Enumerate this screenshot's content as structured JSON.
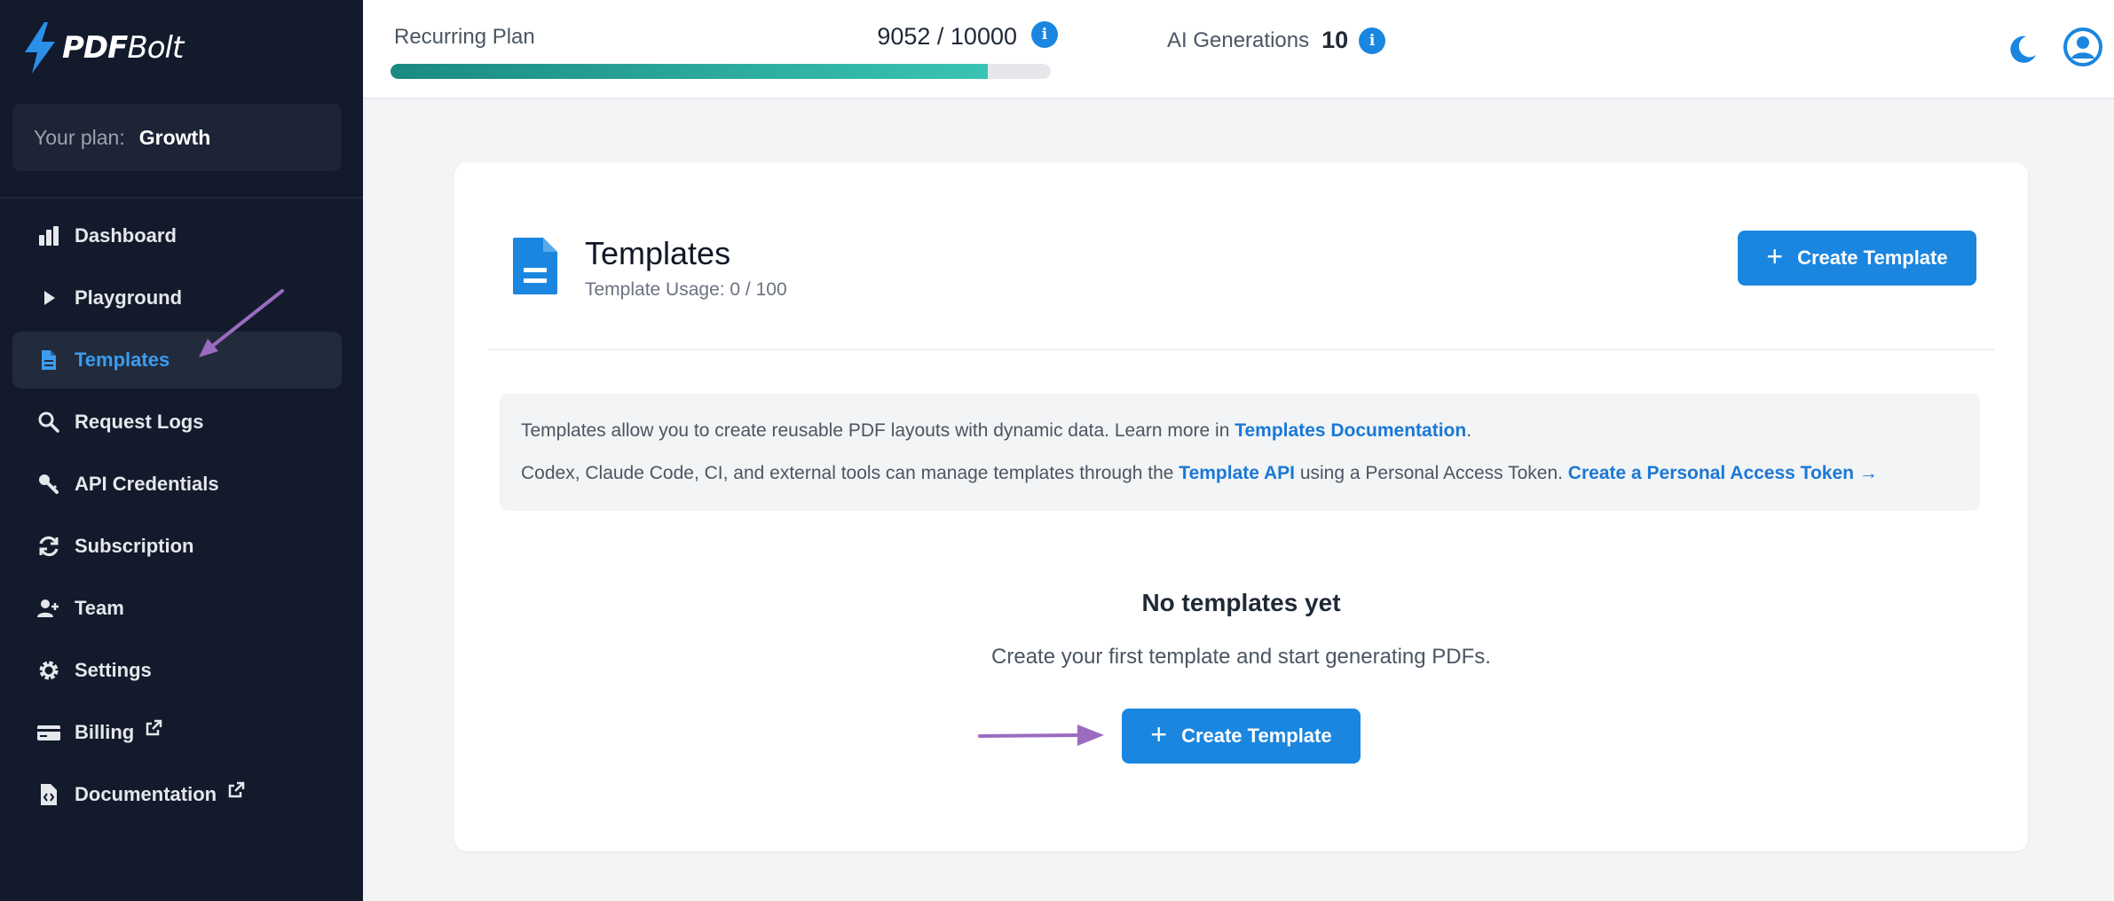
{
  "app": {
    "logo_left": "PDF",
    "logo_right": "Bolt"
  },
  "plan": {
    "label": "Your plan:",
    "value": "Growth"
  },
  "nav": [
    {
      "label": "Dashboard",
      "icon": "bar-chart-icon"
    },
    {
      "label": "Playground",
      "icon": "play-icon"
    },
    {
      "label": "Templates",
      "icon": "document-icon",
      "active": true
    },
    {
      "label": "Request Logs",
      "icon": "search-icon"
    },
    {
      "label": "API Credentials",
      "icon": "key-icon"
    },
    {
      "label": "Subscription",
      "icon": "refresh-icon"
    },
    {
      "label": "Team",
      "icon": "team-icon"
    },
    {
      "label": "Settings",
      "icon": "gear-icon"
    },
    {
      "label": "Billing",
      "icon": "credit-card-icon",
      "external": true
    },
    {
      "label": "Documentation",
      "icon": "code-file-icon",
      "external": true
    }
  ],
  "topbar": {
    "usage_label": "Recurring Plan",
    "usage_count": "9052 / 10000",
    "usage_fraction": 0.9052,
    "ai_label": "AI Generations",
    "ai_count": "10",
    "info_glyph": "i"
  },
  "templates": {
    "title": "Templates",
    "usage": "Template Usage: 0 / 100",
    "create_button": "Create Template",
    "notice_line1_prefix": "Templates allow you to create reusable PDF layouts with dynamic data. Learn more in ",
    "notice_line1_link": "Templates Documentation",
    "notice_line1_suffix": ".",
    "notice_line2_prefix": "Codex, Claude Code, CI, and external tools can manage templates through the ",
    "notice_line2_link1": "Template API",
    "notice_line2_mid": " using a Personal Access Token. ",
    "notice_line2_link2": "Create a Personal Access Token",
    "notice_line2_arrow": "→",
    "empty_title": "No templates yet",
    "empty_sub": "Create your first template and start generating PDFs.",
    "plus_glyph": "+"
  },
  "colors": {
    "sidebar_bg": "#121a2c",
    "accent": "#1a86e0",
    "progress": "#2bab9c",
    "annotation_arrow": "#9b6bc0"
  }
}
